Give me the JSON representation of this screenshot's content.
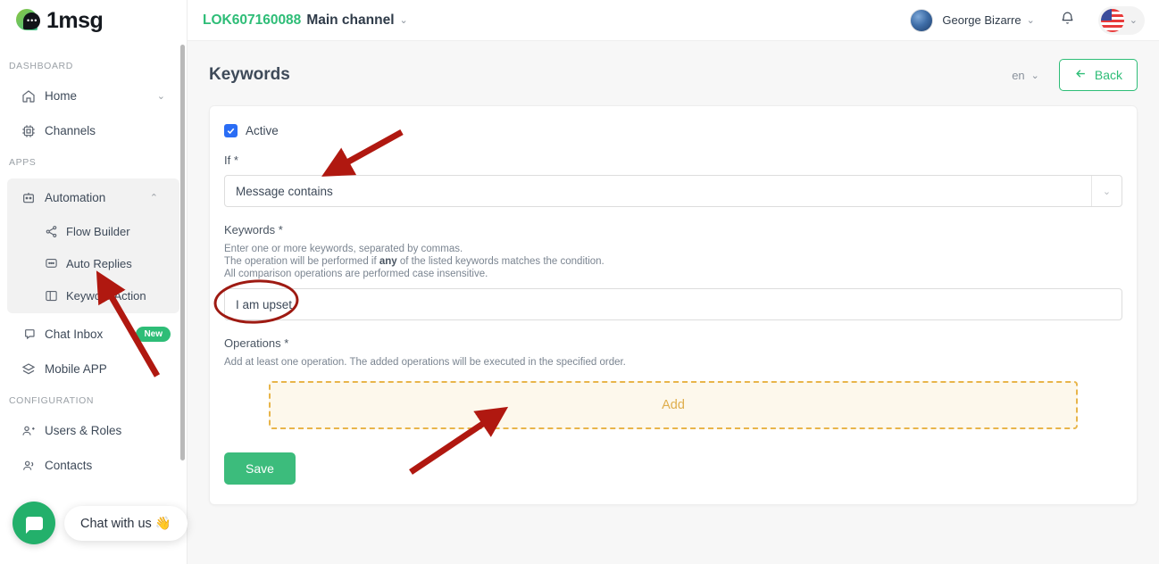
{
  "brand": {
    "name": "1msg",
    "icon": "chat-bubble-logo"
  },
  "topbar": {
    "channel_id": "LOK607160088",
    "channel_name": "Main channel",
    "channel_chevron": "⌄",
    "user_name": "George Bizarre",
    "user_chevron": "⌄",
    "bell_icon": "bell-icon",
    "avatar_icon": "globe-avatar",
    "language_flag": "us-flag",
    "language_chevron": "⌄"
  },
  "sidebar": {
    "sections": [
      {
        "label": "DASHBOARD",
        "items": [
          {
            "label": "Home",
            "icon": "home-icon",
            "chevron": "⌄",
            "name": "home"
          },
          {
            "label": "Channels",
            "icon": "chip-icon",
            "name": "channels"
          }
        ]
      },
      {
        "label": "APPS",
        "items": [
          {
            "label": "Automation",
            "icon": "robot-icon",
            "chevron": "⌃",
            "name": "automation",
            "children": [
              {
                "label": "Flow Builder",
                "icon": "share-nodes-icon",
                "name": "flow-builder"
              },
              {
                "label": "Auto Replies",
                "icon": "message-dots-icon",
                "name": "auto-replies"
              },
              {
                "label": "Keyword Action",
                "icon": "columns-icon",
                "name": "keyword-action"
              }
            ]
          },
          {
            "label": "Chat Inbox",
            "icon": "chat-icon",
            "badge": "New",
            "name": "chat-inbox"
          },
          {
            "label": "Mobile APP",
            "icon": "layers-icon",
            "name": "mobile-app"
          }
        ]
      },
      {
        "label": "CONFIGURATION",
        "items": [
          {
            "label": "Users & Roles",
            "icon": "user-plus-icon",
            "name": "users-roles"
          },
          {
            "label": "Contacts",
            "icon": "users-icon",
            "name": "contacts"
          }
        ]
      }
    ]
  },
  "chat_widget": {
    "label": "Chat with us 👋",
    "icon": "chat-bubble-icon"
  },
  "page": {
    "title": "Keywords",
    "language": "en",
    "language_chevron": "⌄",
    "back_label": "Back",
    "back_icon": "arrow-left-icon"
  },
  "form": {
    "active_label": "Active",
    "active_checked": true,
    "if_label": "If *",
    "if_value": "Message contains",
    "if_chevron": "⌄",
    "keywords_label": "Keywords *",
    "keywords_hint_1": "Enter one or more keywords, separated by commas.",
    "keywords_hint_2a": "The operation will be performed if ",
    "keywords_hint_2b": "any",
    "keywords_hint_2c": " of the listed keywords matches the condition.",
    "keywords_hint_3": "All comparison operations are performed case insensitive.",
    "keywords_value": "I am upset",
    "keywords_placeholder": "",
    "operations_label": "Operations *",
    "operations_hint": "Add at least one operation. The added operations will be executed in the specified order.",
    "add_label": "Add",
    "save_label": "Save"
  },
  "colors": {
    "brand_green": "#2ebd77",
    "save_green": "#3cbc7c",
    "checkbox_blue": "#2a6df5",
    "add_amber": "#e8b54a",
    "annotation_red": "#b01810"
  },
  "annotations": {
    "arrow_to_if_select": "arrow pointing to If dropdown",
    "arrow_to_keyword_action": "arrow pointing to Keyword Action menu item",
    "arrow_to_add_zone": "arrow pointing to Add operations zone",
    "ellipse_on_keywords": "ellipse around keywords input value"
  }
}
